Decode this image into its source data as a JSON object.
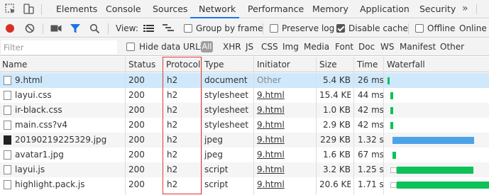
{
  "tabs": [
    {
      "label": "Elements"
    },
    {
      "label": "Console"
    },
    {
      "label": "Sources"
    },
    {
      "label": "Network"
    },
    {
      "label": "Performance"
    },
    {
      "label": "Memory"
    },
    {
      "label": "Application"
    },
    {
      "label": "Security"
    }
  ],
  "active_tab": "Network",
  "more_tabs": "»",
  "toolbar": {
    "view_label": "View:",
    "group_by_frame": {
      "label": "Group by frame",
      "checked": false
    },
    "preserve_log": {
      "label": "Preserve log",
      "checked": false
    },
    "disable_cache": {
      "label": "Disable cache",
      "checked": true
    },
    "offline": {
      "label": "Offline",
      "checked": false
    },
    "online_label": "Online"
  },
  "filter": {
    "placeholder": "Filter",
    "hide_data_urls": {
      "label": "Hide data URLs",
      "checked": false
    },
    "all_label": "All",
    "types": [
      "XHR",
      "JS",
      "CSS",
      "Img",
      "Media",
      "Font",
      "Doc",
      "WS",
      "Manifest",
      "Other"
    ]
  },
  "columns": [
    "Name",
    "Status",
    "Protocol",
    "Type",
    "Initiator",
    "Size",
    "Time",
    "Waterfall"
  ],
  "rows": [
    {
      "name": "9.html",
      "status": "200",
      "protocol": "h2",
      "type": "document",
      "initiator": "Other",
      "size": "5.4 KB",
      "time": "26 ms"
    },
    {
      "name": "layui.css",
      "status": "200",
      "protocol": "h2",
      "type": "stylesheet",
      "initiator": "9.html",
      "size": "15.4 KB",
      "time": "44 ms"
    },
    {
      "name": "ir-black.css",
      "status": "200",
      "protocol": "h2",
      "type": "stylesheet",
      "initiator": "9.html",
      "size": "1.0 KB",
      "time": "42 ms"
    },
    {
      "name": "main.css?v4",
      "status": "200",
      "protocol": "h2",
      "type": "stylesheet",
      "initiator": "9.html",
      "size": "2.9 KB",
      "time": "42 ms"
    },
    {
      "name": "20190219225329.jpg",
      "status": "200",
      "protocol": "h2",
      "type": "jpeg",
      "initiator": "9.html",
      "size": "229 KB",
      "time": "1.32 s"
    },
    {
      "name": "avatar1.jpg",
      "status": "200",
      "protocol": "h2",
      "type": "jpeg",
      "initiator": "9.html",
      "size": "1.6 KB",
      "time": "67 ms"
    },
    {
      "name": "layui.js",
      "status": "200",
      "protocol": "h2",
      "type": "script",
      "initiator": "9.html",
      "size": "3.2 KB",
      "time": "1.25 s"
    },
    {
      "name": "highlight.pack.js",
      "status": "200",
      "protocol": "h2",
      "type": "script",
      "initiator": "9.html",
      "size": "20.6 KB",
      "time": "1.71 s"
    }
  ],
  "colors": {
    "accent": "#1a73e8",
    "record": "#d93025",
    "highlight_box": "#e53935",
    "waterfall_green": "#0cc259",
    "waterfall_blue": "#4da3e8"
  }
}
